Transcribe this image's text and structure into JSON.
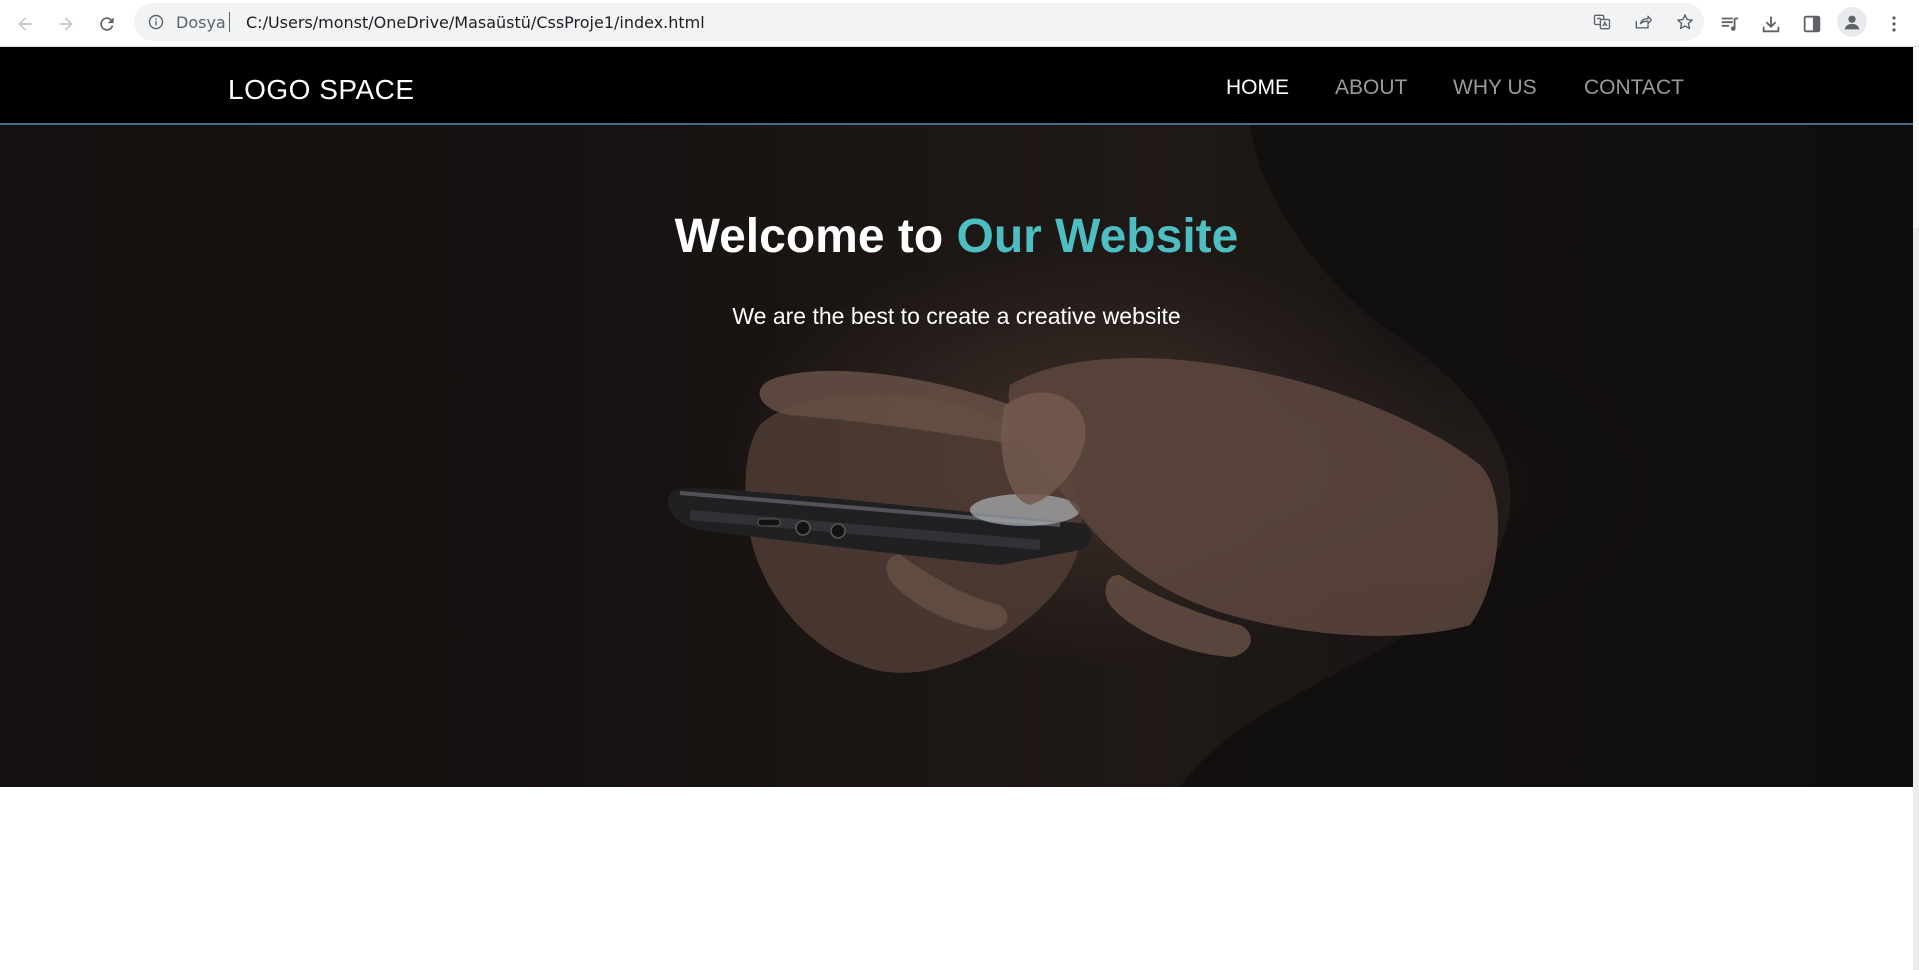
{
  "browser": {
    "site_label": "Dosya",
    "url": "C:/Users/monst/OneDrive/Masaüstü/CssProje1/index.html",
    "icons": [
      "back-arrow-icon",
      "forward-arrow-icon",
      "reload-icon",
      "info-icon",
      "translate-icon",
      "share-icon",
      "star-icon",
      "media-queue-icon",
      "download-icon",
      "side-panel-icon",
      "profile-icon",
      "more-vert-icon"
    ]
  },
  "header": {
    "logo": "LOGO SPACE",
    "nav": [
      {
        "label": "HOME",
        "active": true
      },
      {
        "label": "ABOUT",
        "active": false
      },
      {
        "label": "WHY US",
        "active": false
      },
      {
        "label": "CONTACT",
        "active": false
      }
    ]
  },
  "hero": {
    "title_prefix": "Welcome to ",
    "title_accent": "Our Website",
    "subtitle": "We are the best to create a creative website"
  },
  "colors": {
    "accent": "#4dbec2",
    "header_bg": "#000000",
    "header_border": "#3f6d8a"
  }
}
